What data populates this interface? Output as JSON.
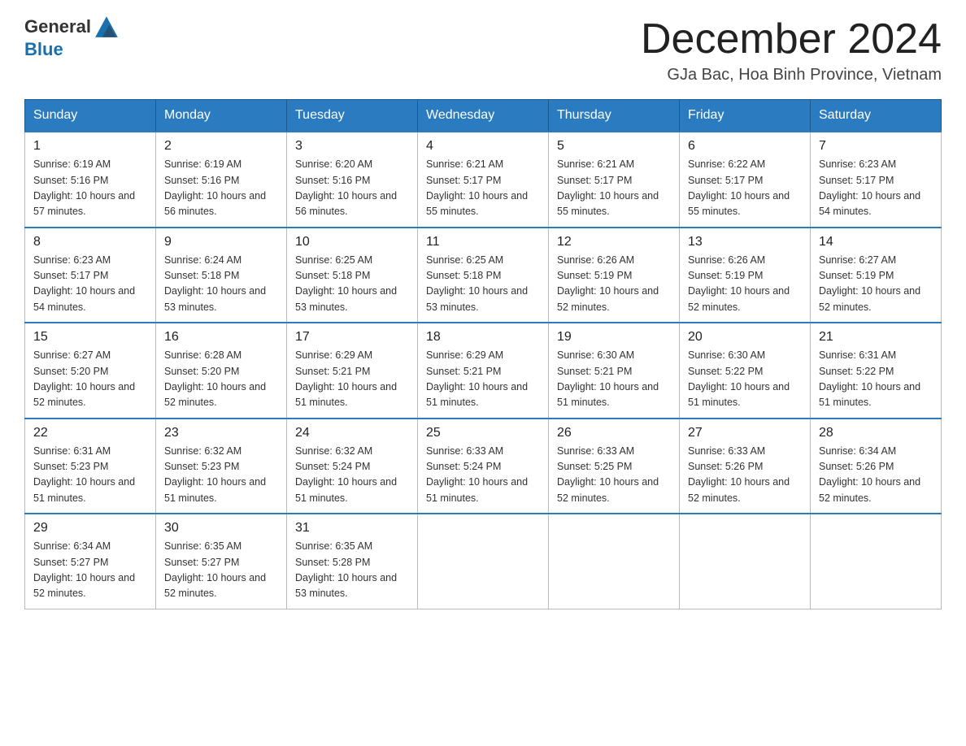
{
  "header": {
    "logo": {
      "general": "General",
      "blue": "Blue"
    },
    "title": "December 2024",
    "location": "GJa Bac, Hoa Binh Province, Vietnam"
  },
  "weekdays": [
    "Sunday",
    "Monday",
    "Tuesday",
    "Wednesday",
    "Thursday",
    "Friday",
    "Saturday"
  ],
  "weeks": [
    [
      {
        "day": "1",
        "sunrise": "6:19 AM",
        "sunset": "5:16 PM",
        "daylight": "10 hours and 57 minutes."
      },
      {
        "day": "2",
        "sunrise": "6:19 AM",
        "sunset": "5:16 PM",
        "daylight": "10 hours and 56 minutes."
      },
      {
        "day": "3",
        "sunrise": "6:20 AM",
        "sunset": "5:16 PM",
        "daylight": "10 hours and 56 minutes."
      },
      {
        "day": "4",
        "sunrise": "6:21 AM",
        "sunset": "5:17 PM",
        "daylight": "10 hours and 55 minutes."
      },
      {
        "day": "5",
        "sunrise": "6:21 AM",
        "sunset": "5:17 PM",
        "daylight": "10 hours and 55 minutes."
      },
      {
        "day": "6",
        "sunrise": "6:22 AM",
        "sunset": "5:17 PM",
        "daylight": "10 hours and 55 minutes."
      },
      {
        "day": "7",
        "sunrise": "6:23 AM",
        "sunset": "5:17 PM",
        "daylight": "10 hours and 54 minutes."
      }
    ],
    [
      {
        "day": "8",
        "sunrise": "6:23 AM",
        "sunset": "5:17 PM",
        "daylight": "10 hours and 54 minutes."
      },
      {
        "day": "9",
        "sunrise": "6:24 AM",
        "sunset": "5:18 PM",
        "daylight": "10 hours and 53 minutes."
      },
      {
        "day": "10",
        "sunrise": "6:25 AM",
        "sunset": "5:18 PM",
        "daylight": "10 hours and 53 minutes."
      },
      {
        "day": "11",
        "sunrise": "6:25 AM",
        "sunset": "5:18 PM",
        "daylight": "10 hours and 53 minutes."
      },
      {
        "day": "12",
        "sunrise": "6:26 AM",
        "sunset": "5:19 PM",
        "daylight": "10 hours and 52 minutes."
      },
      {
        "day": "13",
        "sunrise": "6:26 AM",
        "sunset": "5:19 PM",
        "daylight": "10 hours and 52 minutes."
      },
      {
        "day": "14",
        "sunrise": "6:27 AM",
        "sunset": "5:19 PM",
        "daylight": "10 hours and 52 minutes."
      }
    ],
    [
      {
        "day": "15",
        "sunrise": "6:27 AM",
        "sunset": "5:20 PM",
        "daylight": "10 hours and 52 minutes."
      },
      {
        "day": "16",
        "sunrise": "6:28 AM",
        "sunset": "5:20 PM",
        "daylight": "10 hours and 52 minutes."
      },
      {
        "day": "17",
        "sunrise": "6:29 AM",
        "sunset": "5:21 PM",
        "daylight": "10 hours and 51 minutes."
      },
      {
        "day": "18",
        "sunrise": "6:29 AM",
        "sunset": "5:21 PM",
        "daylight": "10 hours and 51 minutes."
      },
      {
        "day": "19",
        "sunrise": "6:30 AM",
        "sunset": "5:21 PM",
        "daylight": "10 hours and 51 minutes."
      },
      {
        "day": "20",
        "sunrise": "6:30 AM",
        "sunset": "5:22 PM",
        "daylight": "10 hours and 51 minutes."
      },
      {
        "day": "21",
        "sunrise": "6:31 AM",
        "sunset": "5:22 PM",
        "daylight": "10 hours and 51 minutes."
      }
    ],
    [
      {
        "day": "22",
        "sunrise": "6:31 AM",
        "sunset": "5:23 PM",
        "daylight": "10 hours and 51 minutes."
      },
      {
        "day": "23",
        "sunrise": "6:32 AM",
        "sunset": "5:23 PM",
        "daylight": "10 hours and 51 minutes."
      },
      {
        "day": "24",
        "sunrise": "6:32 AM",
        "sunset": "5:24 PM",
        "daylight": "10 hours and 51 minutes."
      },
      {
        "day": "25",
        "sunrise": "6:33 AM",
        "sunset": "5:24 PM",
        "daylight": "10 hours and 51 minutes."
      },
      {
        "day": "26",
        "sunrise": "6:33 AM",
        "sunset": "5:25 PM",
        "daylight": "10 hours and 52 minutes."
      },
      {
        "day": "27",
        "sunrise": "6:33 AM",
        "sunset": "5:26 PM",
        "daylight": "10 hours and 52 minutes."
      },
      {
        "day": "28",
        "sunrise": "6:34 AM",
        "sunset": "5:26 PM",
        "daylight": "10 hours and 52 minutes."
      }
    ],
    [
      {
        "day": "29",
        "sunrise": "6:34 AM",
        "sunset": "5:27 PM",
        "daylight": "10 hours and 52 minutes."
      },
      {
        "day": "30",
        "sunrise": "6:35 AM",
        "sunset": "5:27 PM",
        "daylight": "10 hours and 52 minutes."
      },
      {
        "day": "31",
        "sunrise": "6:35 AM",
        "sunset": "5:28 PM",
        "daylight": "10 hours and 53 minutes."
      },
      null,
      null,
      null,
      null
    ]
  ]
}
